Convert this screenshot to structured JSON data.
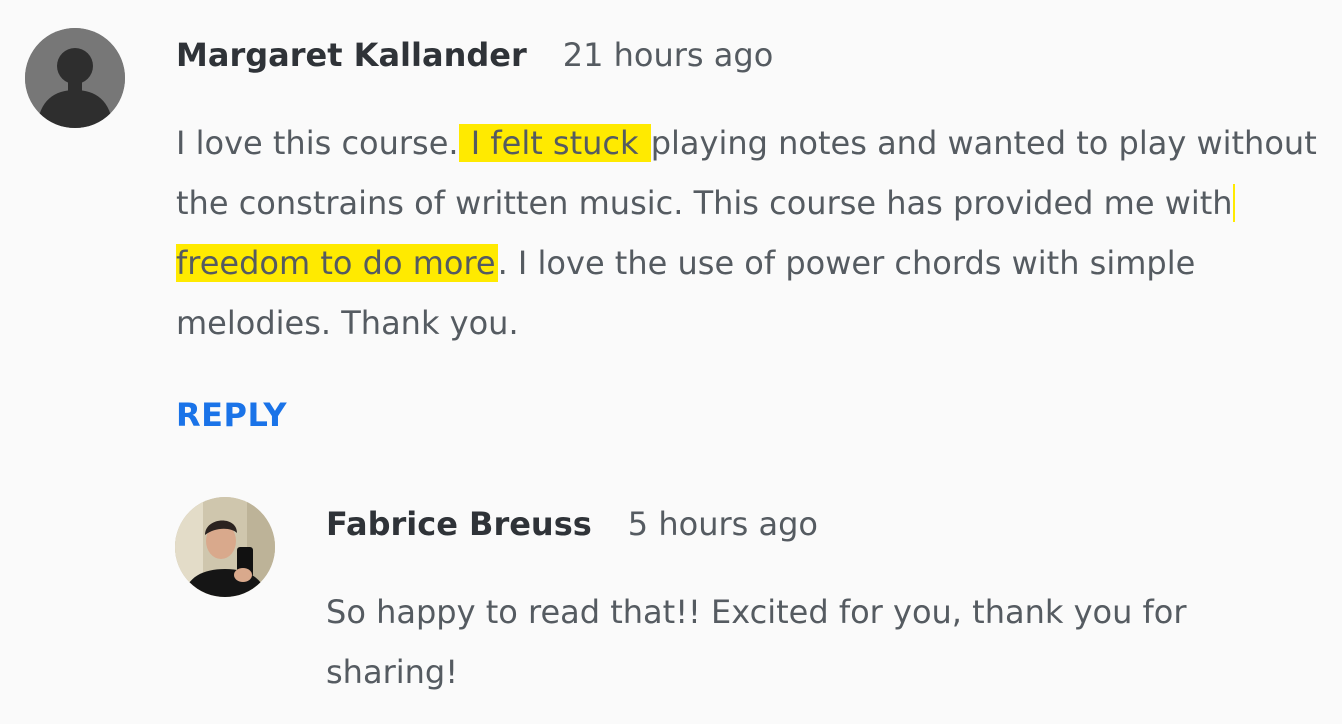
{
  "comments": [
    {
      "author": "Margaret Kallander",
      "time": "21 hours ago",
      "body": {
        "p1": "I love this course.",
        "h1": " I felt stuck ",
        "p2": "playing notes and wanted to play without the constrains of written music. This course has provided me with",
        "h2": " freedom to do more",
        "p3": ". I love the use of power chords with simple melodies. Thank you."
      },
      "reply_label": "REPLY",
      "avatar": "default-user-silhouette"
    }
  ],
  "replies": [
    {
      "author": "Fabrice Breuss",
      "time": "5 hours ago",
      "body": "So happy to read that!! Excited for you, thank you for sharing!",
      "avatar": "user-photo"
    }
  ],
  "colors": {
    "background": "#fafafa",
    "text": "#555b61",
    "author": "#2f3338",
    "highlight": "#ffea00",
    "link": "#1a73e8"
  }
}
